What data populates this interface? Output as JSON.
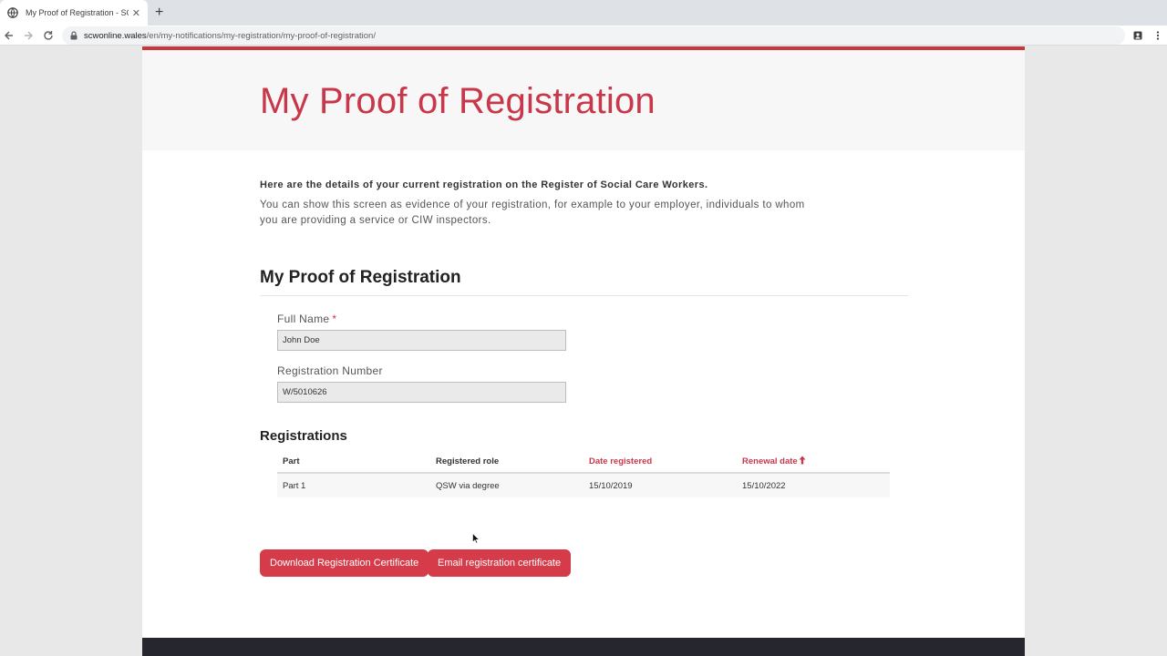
{
  "browser": {
    "tab_title": "My Proof of Registration - SCW P",
    "url_domain": "scwonline.wales",
    "url_path": "/en/my-notifications/my-registration/my-proof-of-registration/"
  },
  "page": {
    "hero_title": "My Proof of Registration",
    "intro_bold": "Here are the details of your current registration on the Register of Social Care Workers.",
    "intro_text": "You can show this screen as evidence of your registration, for example to your employer, individuals to whom you are providing a service or CIW inspectors.",
    "section_title": "My Proof of Registration",
    "full_name_label": "Full Name",
    "required_mark": "*",
    "full_name_value": "John Doe",
    "reg_number_label": "Registration Number",
    "reg_number_value": "W/5010626",
    "registrations_title": "Registrations",
    "table": {
      "headers": [
        "Part",
        "Registered role",
        "Date registered",
        "Renewal date"
      ],
      "rows": [
        [
          "Part 1",
          "QSW via degree",
          "15/10/2019",
          "15/10/2022"
        ]
      ]
    },
    "download_button": "Download Registration Certificate",
    "email_button": "Email registration certificate"
  },
  "colors": {
    "accent": "#c8374a",
    "button": "#d53b48",
    "footer": "#26262e"
  }
}
